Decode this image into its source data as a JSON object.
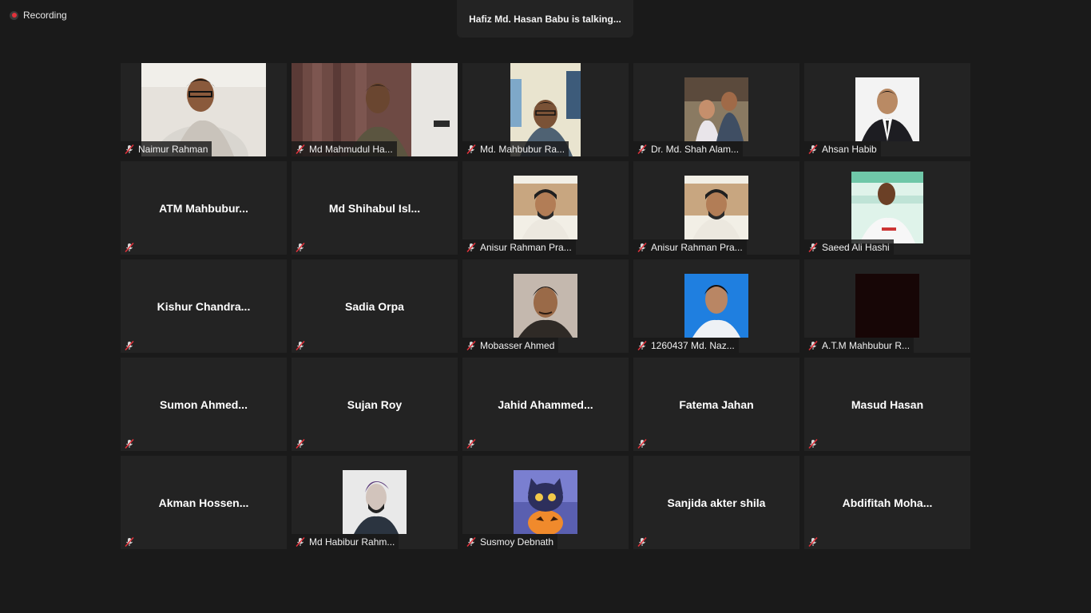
{
  "recording": {
    "label": "Recording",
    "color": "#e0313a"
  },
  "speaker_banner": {
    "text": "Hafiz Md. Hasan Babu is talking..."
  },
  "participants": [
    {
      "name": "Naimur Rahman",
      "tile_text": "",
      "media": "video",
      "muted": true
    },
    {
      "name": "Md Mahmudul Ha...",
      "tile_text": "",
      "media": "video",
      "muted": true
    },
    {
      "name": "Md. Mahbubur Ra...",
      "tile_text": "",
      "media": "video",
      "muted": true
    },
    {
      "name": "Dr. Md. Shah Alam...",
      "tile_text": "",
      "media": "photo",
      "muted": true
    },
    {
      "name": "Ahsan Habib",
      "tile_text": "",
      "media": "photo",
      "muted": true
    },
    {
      "name": "",
      "tile_text": "ATM  Mahbubur...",
      "media": "none",
      "muted": true
    },
    {
      "name": "",
      "tile_text": "Md  Shihabul  Isl...",
      "media": "none",
      "muted": true
    },
    {
      "name": "Anisur Rahman Pra...",
      "tile_text": "",
      "media": "photo",
      "muted": true
    },
    {
      "name": "Anisur Rahman Pra...",
      "tile_text": "",
      "media": "photo",
      "muted": true
    },
    {
      "name": "Saeed Ali Hashi",
      "tile_text": "",
      "media": "photo",
      "muted": true
    },
    {
      "name": "",
      "tile_text": "Kishur  Chandra...",
      "media": "none",
      "muted": true
    },
    {
      "name": "",
      "tile_text": "Sadia Orpa",
      "media": "none",
      "muted": true
    },
    {
      "name": "Mobasser Ahmed",
      "tile_text": "",
      "media": "photo",
      "muted": true
    },
    {
      "name": "1260437 Md. Naz...",
      "tile_text": "",
      "media": "photo",
      "muted": true
    },
    {
      "name": "A.T.M Mahbubur R...",
      "tile_text": "",
      "media": "photo",
      "muted": true
    },
    {
      "name": "",
      "tile_text": "Sumon  Ahmed...",
      "media": "none",
      "muted": true
    },
    {
      "name": "",
      "tile_text": "Sujan Roy",
      "media": "none",
      "muted": true
    },
    {
      "name": "",
      "tile_text": "Jahid  Ahammed...",
      "media": "none",
      "muted": true
    },
    {
      "name": "",
      "tile_text": "Fatema Jahan",
      "media": "none",
      "muted": true
    },
    {
      "name": "",
      "tile_text": "Masud Hasan",
      "media": "none",
      "muted": true
    },
    {
      "name": "",
      "tile_text": "Akman  Hossen...",
      "media": "none",
      "muted": true
    },
    {
      "name": "Md Habibur Rahm...",
      "tile_text": "",
      "media": "photo",
      "muted": true
    },
    {
      "name": "Susmoy Debnath",
      "tile_text": "",
      "media": "photo",
      "muted": true
    },
    {
      "name": "",
      "tile_text": "Sanjida akter shila",
      "media": "none",
      "muted": true
    },
    {
      "name": "",
      "tile_text": "Abdifitah  Moha...",
      "media": "none",
      "muted": true
    }
  ],
  "icons": {
    "muted_mic": "muted-mic-icon",
    "recording": "recording-icon"
  }
}
